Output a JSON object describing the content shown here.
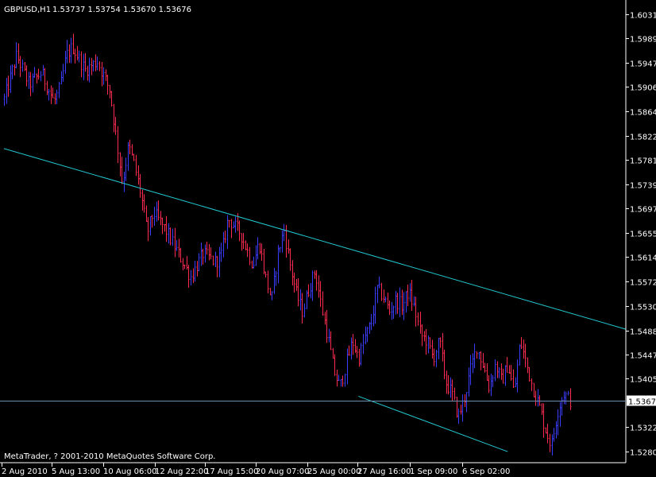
{
  "header": {
    "symbol_period": "GBPUSD,H1",
    "ohlc": "1.53737 1.53754 1.53670 1.53676"
  },
  "footer": {
    "copyright": "MetaTrader, ? 2001-2010 MetaQuotes Software Corp."
  },
  "colors": {
    "background": "#000000",
    "axis": "#ffffff",
    "bull_bar": "#3a3cff",
    "bear_bar": "#ff2a4f",
    "trendline": "#22c7cf",
    "price_line": "#6f8fb0"
  },
  "chart_data": {
    "type": "ohlc-bar",
    "symbol": "GBPUSD",
    "timeframe": "H1",
    "last_price": "1.53676",
    "price_axis": {
      "range": [
        1.5261,
        1.6055
      ],
      "ticks": [
        "1.60310",
        "1.59890",
        "1.59470",
        "1.59060",
        "1.58640",
        "1.58220",
        "1.57810",
        "1.57390",
        "1.56970",
        "1.56550",
        "1.56140",
        "1.55720",
        "1.55300",
        "1.54880",
        "1.54470",
        "1.54050",
        "1.53220",
        "1.52800"
      ]
    },
    "time_axis": {
      "ticks": [
        "2 Aug 2010",
        "5 Aug 13:00",
        "10 Aug 06:00",
        "12 Aug 22:00",
        "17 Aug 15:00",
        "20 Aug 07:00",
        "25 Aug 00:00",
        "27 Aug 16:00",
        "1 Sep 09:00",
        "6 Sep 02:00"
      ]
    },
    "price_path": [
      [
        0,
        1.5885
      ],
      [
        2,
        1.596
      ],
      [
        4,
        1.591
      ],
      [
        6,
        1.593
      ],
      [
        8,
        1.588
      ],
      [
        9,
        1.5905
      ],
      [
        10,
        1.596
      ],
      [
        11,
        1.5975
      ],
      [
        13,
        1.5935
      ],
      [
        15,
        1.595
      ],
      [
        17,
        1.59
      ],
      [
        19,
        1.574
      ],
      [
        20,
        1.5805
      ],
      [
        21,
        1.577
      ],
      [
        22,
        1.572
      ],
      [
        23,
        1.5655
      ],
      [
        24,
        1.569
      ],
      [
        26,
        1.566
      ],
      [
        28,
        1.562
      ],
      [
        30,
        1.558
      ],
      [
        32,
        1.562
      ],
      [
        34,
        1.5605
      ],
      [
        35,
        1.562
      ],
      [
        36,
        1.568
      ],
      [
        38,
        1.5655
      ],
      [
        40,
        1.56
      ],
      [
        41,
        1.564
      ],
      [
        42,
        1.558
      ],
      [
        43,
        1.554
      ],
      [
        44,
        1.562
      ],
      [
        45,
        1.566
      ],
      [
        46,
        1.56
      ],
      [
        47,
        1.555
      ],
      [
        48,
        1.552
      ],
      [
        49,
        1.556
      ],
      [
        50,
        1.559
      ],
      [
        51,
        1.553
      ],
      [
        52,
        1.548
      ],
      [
        53,
        1.542
      ],
      [
        54,
        1.539
      ],
      [
        55,
        1.543
      ],
      [
        56,
        1.547
      ],
      [
        57,
        1.544
      ],
      [
        58,
        1.5475
      ],
      [
        59,
        1.55
      ],
      [
        60,
        1.556
      ],
      [
        61,
        1.5545
      ],
      [
        62,
        1.552
      ],
      [
        63,
        1.554
      ],
      [
        64,
        1.553
      ],
      [
        65,
        1.5555
      ],
      [
        66,
        1.5525
      ],
      [
        67,
        1.548
      ],
      [
        68,
        1.547
      ],
      [
        69,
        1.544
      ],
      [
        70,
        1.547
      ],
      [
        71,
        1.54
      ],
      [
        72,
        1.538
      ],
      [
        73,
        1.534
      ],
      [
        74,
        1.537
      ],
      [
        75,
        1.542
      ],
      [
        76,
        1.546
      ],
      [
        77,
        1.543
      ],
      [
        78,
        1.539
      ],
      [
        79,
        1.543
      ],
      [
        80,
        1.54
      ],
      [
        81,
        1.543
      ],
      [
        82,
        1.538
      ],
      [
        83,
        1.547
      ],
      [
        84,
        1.543
      ],
      [
        85,
        1.539
      ],
      [
        86,
        1.536
      ],
      [
        87,
        1.532
      ],
      [
        88,
        1.529
      ],
      [
        89,
        1.535
      ],
      [
        90,
        1.538
      ],
      [
        91,
        1.5368
      ]
    ],
    "trendlines": [
      {
        "name": "upper",
        "points": [
          [
            0,
            1.58
          ],
          [
            100,
            1.549
          ]
        ]
      },
      {
        "name": "lower",
        "points": [
          [
            57,
            1.5375
          ],
          [
            81,
            1.528
          ]
        ]
      }
    ]
  }
}
